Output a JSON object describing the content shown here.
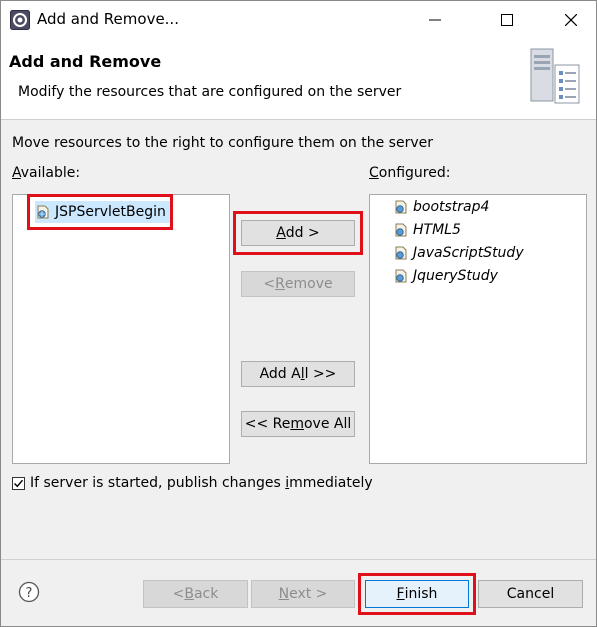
{
  "window": {
    "title": "Add and Remove..."
  },
  "banner": {
    "title": "Add and Remove",
    "description": "Modify the resources that are configured on the server"
  },
  "instructions": "Move resources to the right to configure them on the server",
  "available": {
    "label_prefix": "",
    "label_mnemonic": "A",
    "label_rest": "vailable:",
    "items": [
      "JSPServletBegin"
    ],
    "selected": "JSPServletBegin"
  },
  "configured": {
    "label_mnemonic": "C",
    "label_rest": "onfigured:",
    "items": [
      "bootstrap4",
      "HTML5",
      "JavaScriptStudy",
      "JqueryStudy"
    ]
  },
  "buttons": {
    "add": {
      "m": "A",
      "rest": "dd >"
    },
    "remove": {
      "pre": "< ",
      "m": "R",
      "rest": "emove"
    },
    "add_all": {
      "pre": "Add A",
      "m": "l",
      "rest": "l >>"
    },
    "remove_all": {
      "pre": "<< Re",
      "m": "m",
      "rest": "ove All"
    }
  },
  "publish_checkbox": {
    "checked": true,
    "pre": "If server is started, publish changes ",
    "m": "i",
    "rest": "mmediately"
  },
  "footer": {
    "back": {
      "pre": "< ",
      "m": "B",
      "rest": "ack"
    },
    "next": {
      "m": "N",
      "rest": "ext >"
    },
    "finish": {
      "m": "F",
      "rest": "inish"
    },
    "cancel": "Cancel"
  },
  "colors": {
    "highlight": "#e0101a",
    "selection": "#cce8ff",
    "default_button_border": "#0078d7"
  }
}
